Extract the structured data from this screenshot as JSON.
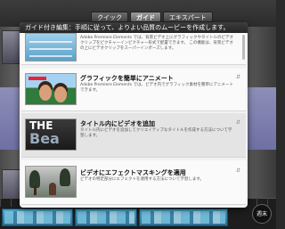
{
  "tabs": [
    {
      "label": "クイック"
    },
    {
      "label": "ガイド"
    },
    {
      "label": "エキスパート"
    }
  ],
  "panel": {
    "header": "ガイド付き編集：手順に従って、よりよい品質のムービーを作成します。",
    "items": [
      {
        "title": "",
        "description": "Adobe Premiere Elements では、背景ビデオ上にグラフィックやタイトルのビデオクリップをピクチャーインピクチャー形式で配置できます。 この機能は、背景ビデオの上にビデオクリップをスーパーインポーズします。",
        "icon": "picture-in-picture-thumbnail"
      },
      {
        "title": "グラフィックを簡単にアニメート",
        "description": "Adobe Premiere Elements では、ビデオ内でグラフィック素材を簡単にアニメートできます。",
        "icon": "animate-graphics-thumbnail"
      },
      {
        "title": "タイトル内にビデオを追加",
        "description": "タイトル内にビデオを追加してクリエイティブなタイトルを作成する方法について学習します。",
        "icon": "video-in-title-thumbnail",
        "thumb_text": "THE",
        "thumb_text2": "Bea"
      },
      {
        "title": "ビデオにエフェクトマスキングを適用",
        "description": "ビデオの特定部分にエフェクトを適用する方法について学習します。",
        "icon": "effect-masking-thumbnail"
      }
    ]
  },
  "watermark": {
    "text": "週末"
  },
  "colors": {
    "panel_bg": "#f2f2f2",
    "header_bg": "#2f2f2f",
    "highlight": "#e4e4e4",
    "tab_active": "#808080"
  }
}
